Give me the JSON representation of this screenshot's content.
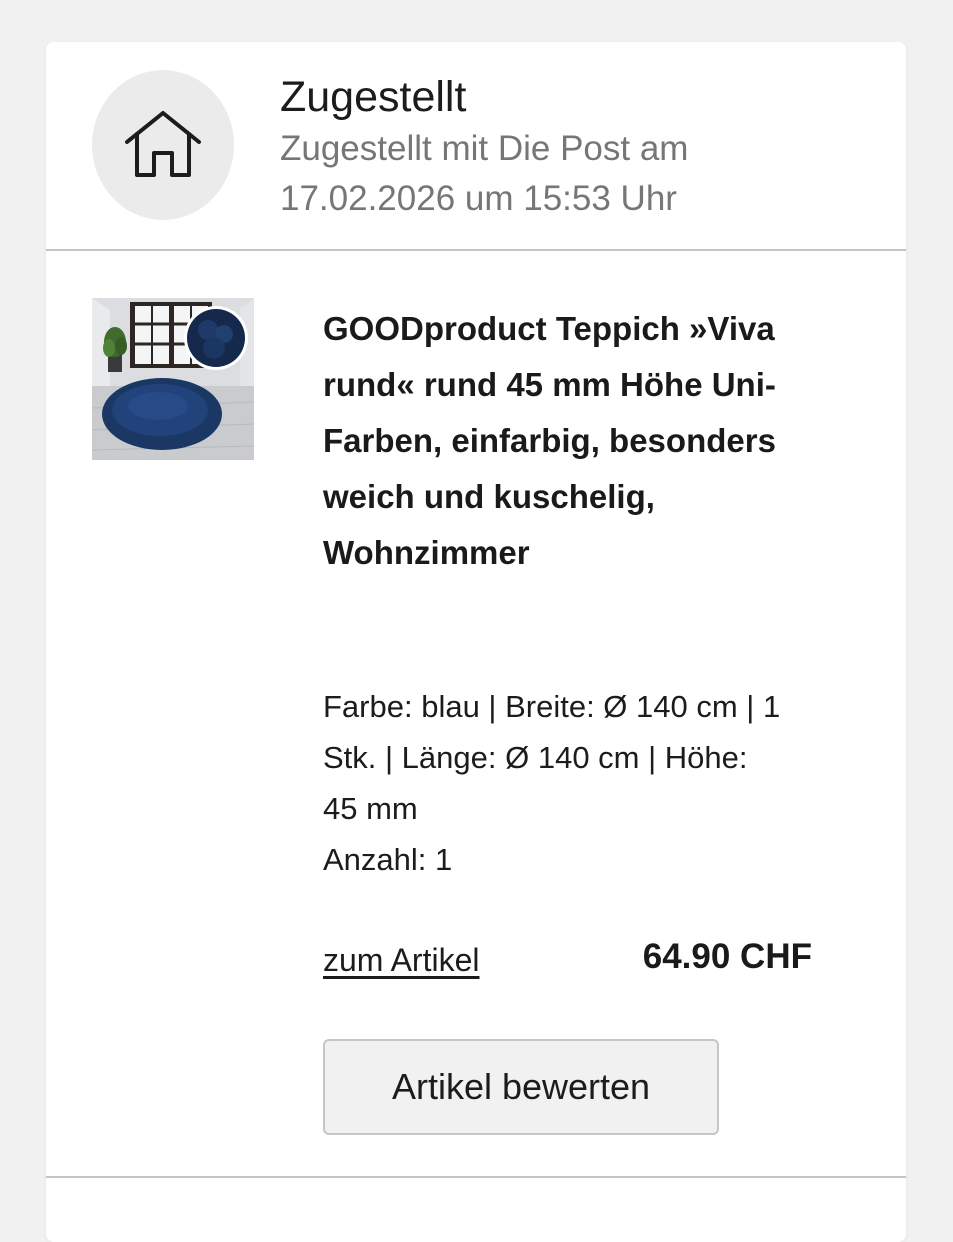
{
  "status": {
    "icon": "house-icon",
    "title": "Zugestellt",
    "description": "Zugestellt mit Die Post am 17.02.2026 um 15:53 Uhr"
  },
  "item": {
    "image_icon": "product-rug-image",
    "title": "GOODproduct Teppich »Viva rund« rund 45 mm Höhe Uni-Farben, einfarbig, besonders weich und kuschelig, Wohnzimmer",
    "attributes": {
      "line1": "Farbe: blau | Breite: Ø 140 cm | 1",
      "line2": "Stk. | Länge: Ø 140 cm | Höhe:",
      "line3": "45 mm",
      "quantity": "Anzahl: 1"
    },
    "link_label": "zum Artikel",
    "price": "64.90 CHF",
    "rate_button_label": "Artikel bewerten"
  },
  "colors": {
    "background": "#f1f1f1",
    "card": "#ffffff",
    "icon_circle": "#ebebeb",
    "secondary_text": "#767676",
    "rug": "#1b3763"
  }
}
